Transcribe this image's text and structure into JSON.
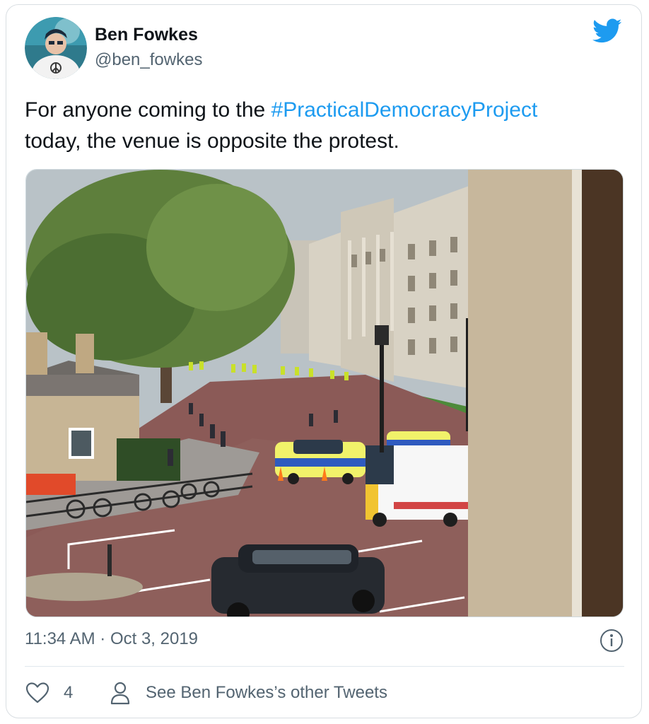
{
  "author": {
    "display_name": "Ben Fowkes",
    "handle": "@ben_fowkes"
  },
  "tweet": {
    "text_before": "For anyone coming to the ",
    "hashtag": "#PracticalDemocracyProject",
    "text_after": " today, the venue is opposite the protest."
  },
  "meta": {
    "timestamp": "11:34 AM · Oct 3, 2019"
  },
  "actions": {
    "like_count": "4",
    "other_tweets_label": "See Ben Fowkes’s other Tweets"
  },
  "icons": {
    "brand": "twitter-bird-icon",
    "info": "info-icon",
    "like": "heart-icon",
    "profile": "user-icon"
  },
  "colors": {
    "brand_blue": "#1d9bf0",
    "secondary_text": "#536471",
    "primary_text": "#0f1419"
  }
}
